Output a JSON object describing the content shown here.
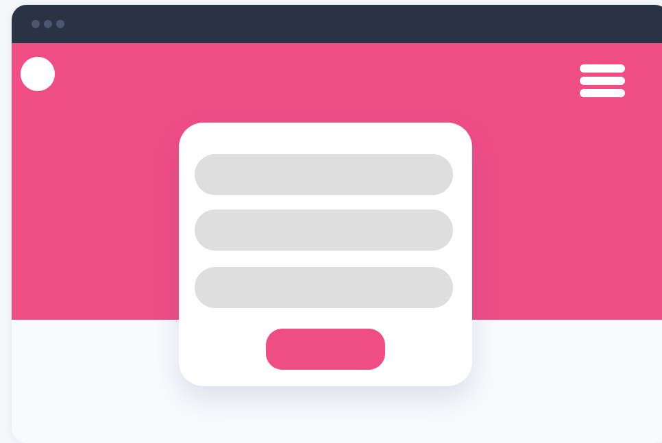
{
  "window": {
    "controls": [
      "dot",
      "dot",
      "dot"
    ]
  },
  "header": {
    "logo_icon": "circle-logo-icon",
    "menu_icon": "hamburger-menu-icon"
  },
  "form": {
    "fields": [
      {
        "value": "",
        "placeholder": ""
      },
      {
        "value": "",
        "placeholder": ""
      },
      {
        "value": "",
        "placeholder": ""
      }
    ],
    "submit_label": ""
  },
  "colors": {
    "titlebar": "#2a3246",
    "window_dot": "#4b5671",
    "accent": "#f04d85",
    "field": "#dedede",
    "card": "#ffffff",
    "page": "#f8fafd"
  }
}
